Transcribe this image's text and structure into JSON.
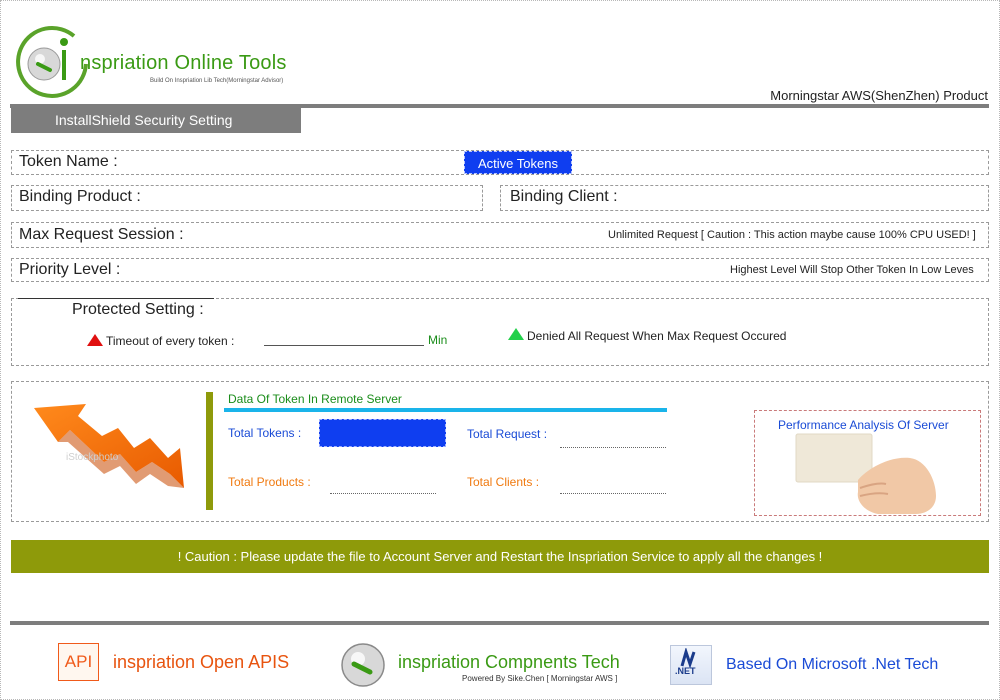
{
  "header": {
    "logo_title": "nspriation Online Tools",
    "logo_subtitle": "Build On Inspriation Lib Tech(Morningstar Advisor)",
    "product": "Morningstar AWS(ShenZhen) Product",
    "section_tab": "InstallShield Security Setting"
  },
  "form": {
    "token_name_label": "Token Name :",
    "active_tokens_button": "Active Tokens",
    "binding_product_label": "Binding Product :",
    "binding_client_label": "Binding Client :",
    "max_request_label": "Max Request Session :",
    "unlimited_note": "Unlimited Request [ Caution : This action maybe cause 100% CPU USED! ]",
    "priority_label": "Priority Level :",
    "priority_note": "Highest Level Will Stop Other Token In Low Leves"
  },
  "protected": {
    "title": "Protected Setting :",
    "timeout_label": "Timeout of every token :",
    "timeout_unit": "Min",
    "denied_label": "Denied All Request When Max Request Occured"
  },
  "remote": {
    "title": "Data Of Token In Remote Server",
    "total_tokens": "Total Tokens :",
    "total_request": "Total Request :",
    "total_products": "Total Products :",
    "total_clients": "Total Clients :",
    "image_watermark": "iStockphoto"
  },
  "performance": {
    "title": "Performance Analysis Of Server"
  },
  "caution": "! Caution : Please update the file to Account Server and Restart the Inspriation Service to apply all the changes !",
  "footer": {
    "api_icon": "API",
    "open_apis": "inspriation Open APIS",
    "components": "inspriation Compnents Tech",
    "powered_by": "Powered By Sike.Chen [ Morningstar AWS ]",
    "net_icon": ".NET",
    "dotnet": "Based On Microsoft .Net Tech"
  },
  "colors": {
    "accent_green": "#3a9a14",
    "active_blue": "#0f3ef0",
    "olive": "#8e9a0a",
    "gray_bar": "#7d7d7d",
    "cyan": "#1ab4ea"
  }
}
